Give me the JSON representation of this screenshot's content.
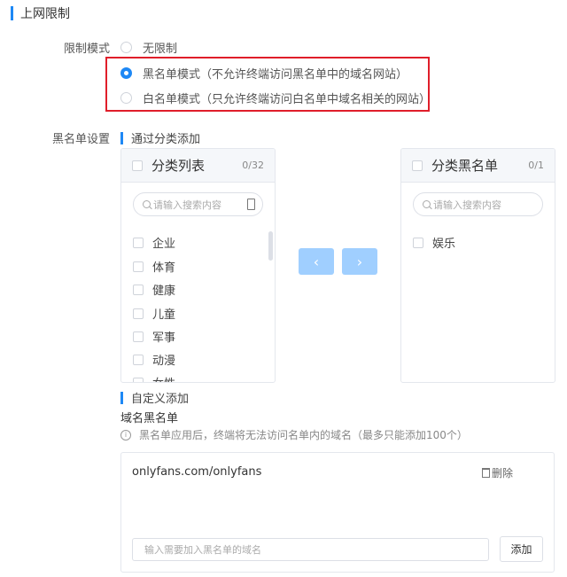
{
  "section": {
    "title": "上网限制"
  },
  "mode": {
    "label": "限制模式",
    "options": [
      {
        "label": "无限制",
        "selected": false
      },
      {
        "label": "黑名单模式（不允许终端访问黑名单中的域名网站）",
        "selected": true
      },
      {
        "label": "白名单模式（只允许终端访问白名单中域名相关的网站）",
        "selected": false
      }
    ]
  },
  "blacklist": {
    "label": "黑名单设置",
    "category_title": "通过分类添加",
    "source": {
      "title": "分类列表",
      "count": "0/32",
      "search_placeholder": "请输入搜索内容",
      "items": [
        "企业",
        "体育",
        "健康",
        "儿童",
        "军事",
        "动漫",
        "女性"
      ]
    },
    "target": {
      "title": "分类黑名单",
      "count": "0/1",
      "search_placeholder": "请输入搜索内容",
      "items": [
        "娱乐"
      ]
    },
    "buttons": {
      "left": "‹",
      "right": "›"
    },
    "custom_title": "自定义添加",
    "domain_label": "域名黑名单",
    "hint": "黑名单应用后，终端将无法访问名单内的域名（最多只能添加100个）",
    "domains": [
      "onlyfans.com/onlyfans"
    ],
    "delete_label": "删除",
    "input_placeholder": "输入需要加入黑名单的域名",
    "add_label": "添加"
  },
  "colors": {
    "accent": "#1e88f5",
    "highlight": "#e01e2a",
    "button": "#a0cfff"
  }
}
